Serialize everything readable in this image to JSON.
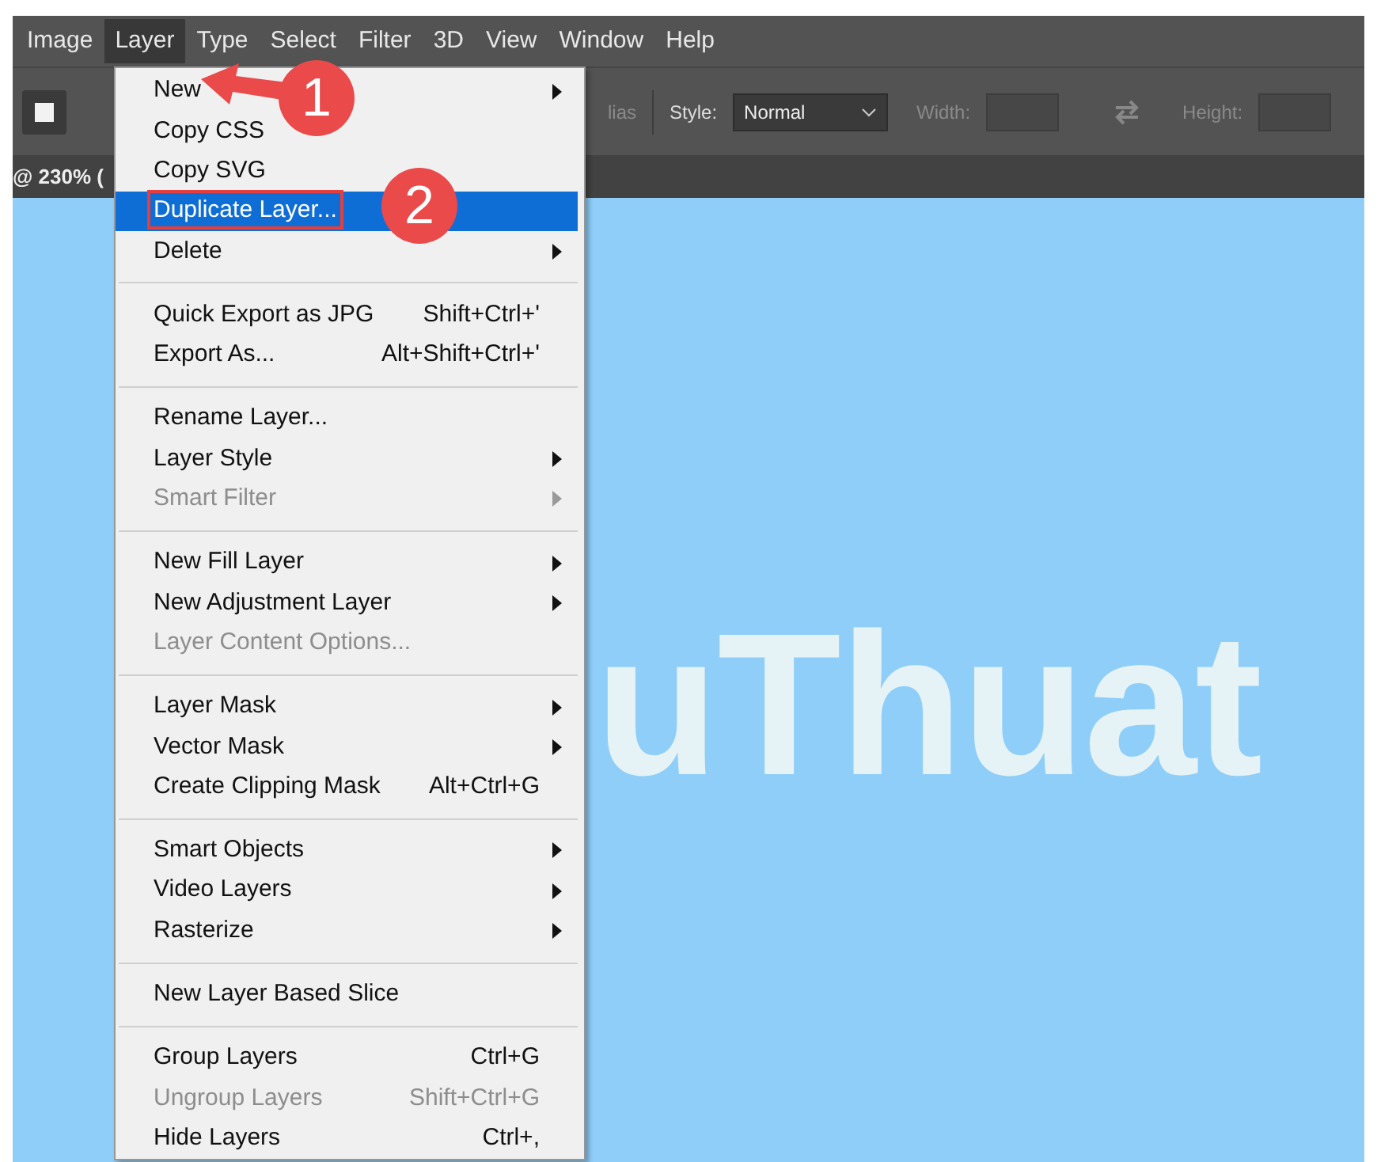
{
  "menubar": [
    {
      "label": "Image",
      "selected": false
    },
    {
      "label": "Layer",
      "selected": true
    },
    {
      "label": "Type",
      "selected": false
    },
    {
      "label": "Select",
      "selected": false
    },
    {
      "label": "Filter",
      "selected": false
    },
    {
      "label": "3D",
      "selected": false
    },
    {
      "label": "View",
      "selected": false
    },
    {
      "label": "Window",
      "selected": false
    },
    {
      "label": "Help",
      "selected": false
    }
  ],
  "options_bar": {
    "partial_label": "lias",
    "style_label": "Style:",
    "style_value": "Normal",
    "width_label": "Width:",
    "height_label": "Height:"
  },
  "document_tab": {
    "title": "@ 230% ("
  },
  "canvas": {
    "text": "uThuat"
  },
  "menu": {
    "groups": [
      [
        {
          "label": "New",
          "submenu": true,
          "disabled": false,
          "selected": false
        },
        {
          "label": "Copy CSS",
          "submenu": false,
          "disabled": false,
          "selected": false
        },
        {
          "label": "Copy SVG",
          "submenu": false,
          "disabled": false,
          "selected": false
        },
        {
          "label": "Duplicate Layer...",
          "submenu": false,
          "disabled": false,
          "selected": true
        },
        {
          "label": "Delete",
          "submenu": true,
          "disabled": false,
          "selected": false
        }
      ],
      [
        {
          "label": "Quick Export as JPG",
          "shortcut": "Shift+Ctrl+'",
          "submenu": false,
          "disabled": false,
          "selected": false
        },
        {
          "label": "Export As...",
          "shortcut": "Alt+Shift+Ctrl+'",
          "submenu": false,
          "disabled": false,
          "selected": false
        }
      ],
      [
        {
          "label": "Rename Layer...",
          "submenu": false,
          "disabled": false,
          "selected": false
        },
        {
          "label": "Layer Style",
          "submenu": true,
          "disabled": false,
          "selected": false
        },
        {
          "label": "Smart Filter",
          "submenu": true,
          "disabled": true,
          "selected": false
        }
      ],
      [
        {
          "label": "New Fill Layer",
          "submenu": true,
          "disabled": false,
          "selected": false
        },
        {
          "label": "New Adjustment Layer",
          "submenu": true,
          "disabled": false,
          "selected": false
        },
        {
          "label": "Layer Content Options...",
          "submenu": false,
          "disabled": true,
          "selected": false
        }
      ],
      [
        {
          "label": "Layer Mask",
          "submenu": true,
          "disabled": false,
          "selected": false
        },
        {
          "label": "Vector Mask",
          "submenu": true,
          "disabled": false,
          "selected": false
        },
        {
          "label": "Create Clipping Mask",
          "shortcut": "Alt+Ctrl+G",
          "submenu": false,
          "disabled": false,
          "selected": false
        }
      ],
      [
        {
          "label": "Smart Objects",
          "submenu": true,
          "disabled": false,
          "selected": false
        },
        {
          "label": "Video Layers",
          "submenu": true,
          "disabled": false,
          "selected": false
        },
        {
          "label": "Rasterize",
          "submenu": true,
          "disabled": false,
          "selected": false
        }
      ],
      [
        {
          "label": "New Layer Based Slice",
          "submenu": false,
          "disabled": false,
          "selected": false
        }
      ],
      [
        {
          "label": "Group Layers",
          "shortcut": "Ctrl+G",
          "submenu": false,
          "disabled": false,
          "selected": false
        },
        {
          "label": "Ungroup Layers",
          "shortcut": "Shift+Ctrl+G",
          "submenu": false,
          "disabled": true,
          "selected": false
        },
        {
          "label": "Hide Layers",
          "shortcut": "Ctrl+,",
          "submenu": false,
          "disabled": false,
          "selected": false
        }
      ]
    ]
  },
  "annotations": [
    {
      "kind": "arrow",
      "number": "1"
    },
    {
      "kind": "circle",
      "number": "2"
    }
  ]
}
